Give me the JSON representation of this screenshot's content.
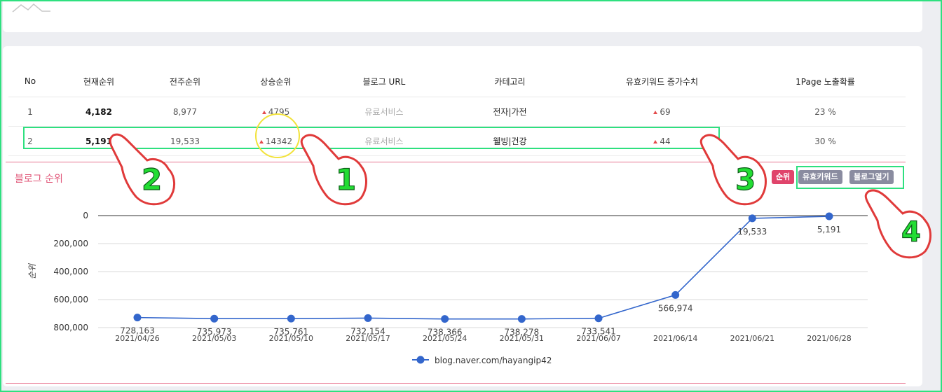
{
  "table": {
    "headers": [
      "No",
      "현재순위",
      "전주순위",
      "상승순위",
      "블로그 URL",
      "카테고리",
      "유효키워드 증가수치",
      "1Page 노출확률"
    ],
    "rows": [
      {
        "no": "1",
        "current": "4,182",
        "prev": "8,977",
        "rise": "4795",
        "url": "유료서비스",
        "category": "전자|가전",
        "kw_increase": "69",
        "prob": "23 %"
      },
      {
        "no": "2",
        "current": "5,191",
        "prev": "19,533",
        "rise": "14342",
        "url": "유료서비스",
        "category": "웰빙|건강",
        "kw_increase": "44",
        "prob": "30 %"
      }
    ]
  },
  "section_title": "블로그 순위",
  "buttons": {
    "rank": "순위",
    "keyword": "유효키워드",
    "open": "블로그열기"
  },
  "annotations": [
    "1",
    "2",
    "3",
    "4"
  ],
  "colors": {
    "accent": "#e0446b",
    "line": "#3366cc",
    "highlight": "#2ee07f",
    "annotation_number": "#22dd33",
    "hand_outline": "#e03a3a"
  },
  "chart_data": {
    "type": "line",
    "categories": [
      "2021/04/26",
      "2021/05/03",
      "2021/05/10",
      "2021/05/17",
      "2021/05/24",
      "2021/05/31",
      "2021/06/07",
      "2021/06/14",
      "2021/06/21",
      "2021/06/28"
    ],
    "series": [
      {
        "name": "blog.naver.com/hayangip42",
        "values": [
          728163,
          735973,
          735761,
          732154,
          738366,
          738278,
          733541,
          566974,
          19533,
          5191
        ],
        "labels": [
          "728,163",
          "735,973",
          "735,761",
          "732,154",
          "738,366",
          "738,278",
          "733,541",
          "566,974",
          "19,533",
          "5,191"
        ]
      }
    ],
    "ylabel": "순위",
    "ylim": [
      0,
      800000
    ],
    "y_reversed": true,
    "yticks": [
      "0",
      "200,000",
      "400,000",
      "600,000",
      "800,000"
    ],
    "grid": true,
    "legend": "bottom"
  }
}
